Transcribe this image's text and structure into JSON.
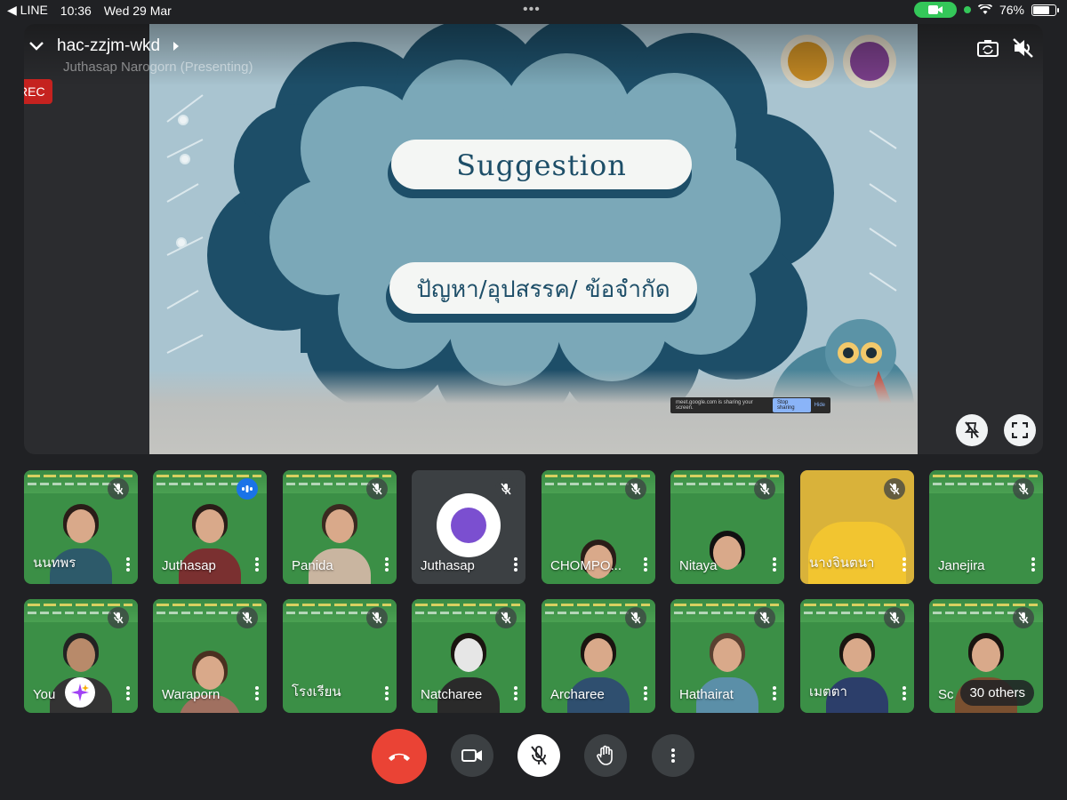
{
  "status_bar": {
    "back_app": "◀ LINE",
    "time": "10:36",
    "date": "Wed 29 Mar",
    "battery": "76%",
    "battery_level": 0.76
  },
  "meeting": {
    "code": "hac-zzjm-wkd",
    "presenter_caption": "Juthasap Narogorn  (Presenting)",
    "rec_label": "REC"
  },
  "slide": {
    "title": "Suggestion",
    "subtitle": "ปัญหา/อุปสรรค/ ข้อจำกัด",
    "share_notice": "meet.google.com is sharing your screen.",
    "stop_sharing": "Stop sharing",
    "hide": "Hide"
  },
  "participants_row1": [
    {
      "name": "นนทพร"
    },
    {
      "name": "Juthasap"
    },
    {
      "name": "Panida"
    },
    {
      "name": "Juthasap"
    },
    {
      "name": "CHOMPO..."
    },
    {
      "name": "Nitaya"
    },
    {
      "name": "นางจินตนา"
    },
    {
      "name": "Janejira"
    }
  ],
  "participants_row2": [
    {
      "name": "You"
    },
    {
      "name": "Waraporn"
    },
    {
      "name": "โรงเรียน"
    },
    {
      "name": "Natcharee"
    },
    {
      "name": "Archaree"
    },
    {
      "name": "Hathairat"
    },
    {
      "name": "เมตตา"
    },
    {
      "name": "Sc"
    }
  ],
  "others_label": "30 others",
  "colors": {
    "background": "#202124",
    "end_call": "#ea4335",
    "rec": "#c5221f",
    "speaking": "#1a73e8",
    "tile_green": "#3b8f46"
  }
}
